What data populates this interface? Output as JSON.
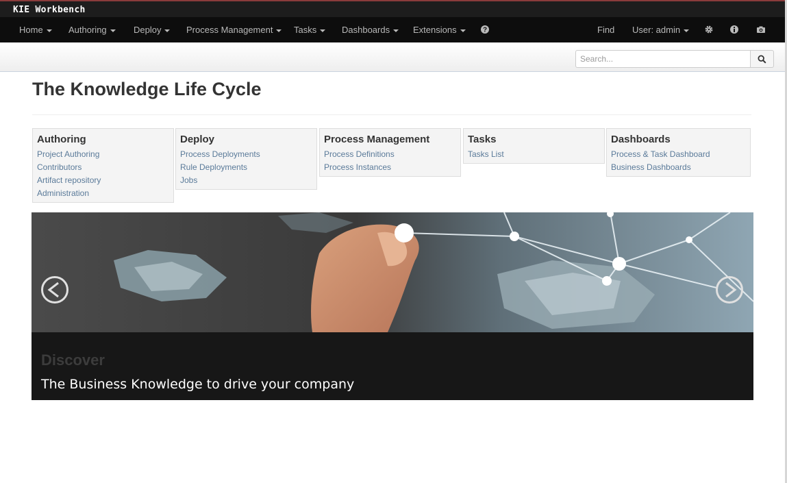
{
  "app": {
    "title": "KIE Workbench"
  },
  "navbar": {
    "left_items": [
      {
        "label": "Home"
      },
      {
        "label": "Authoring"
      },
      {
        "label": "Deploy"
      },
      {
        "label": "Process Management"
      },
      {
        "label": "Tasks"
      },
      {
        "label": "Dashboards"
      },
      {
        "label": "Extensions"
      }
    ],
    "help_icon": "question-circle-icon",
    "find_label": "Find",
    "user_label": "User: admin",
    "right_icons": [
      "gear-icon",
      "info-icon",
      "camera-icon"
    ]
  },
  "search": {
    "placeholder": "Search...",
    "value": "",
    "button_icon": "search-icon"
  },
  "main": {
    "title": "The Knowledge Life Cycle",
    "cards": [
      {
        "title": "Authoring",
        "links": [
          "Project Authoring",
          "Contributors",
          "Artifact repository",
          "Administration"
        ]
      },
      {
        "title": "Deploy",
        "links": [
          "Process Deployments",
          "Rule Deployments",
          "Jobs"
        ]
      },
      {
        "title": "Process Management",
        "links": [
          "Process Definitions",
          "Process Instances"
        ]
      },
      {
        "title": "Tasks",
        "links": [
          "Tasks List"
        ]
      },
      {
        "title": "Dashboards",
        "links": [
          "Process & Task Dashboard",
          "Business Dashboards"
        ]
      }
    ]
  },
  "carousel": {
    "heading": "Discover",
    "text": "The Business Knowledge to drive your company",
    "prev_icon": "chevron-left-circle-icon",
    "next_icon": "chevron-right-circle-icon"
  },
  "colors": {
    "navbar_bg": "#0d0d0d",
    "nav_text": "#b9b9b9",
    "link": "#5a7a99",
    "caption_bg": "#171717"
  }
}
